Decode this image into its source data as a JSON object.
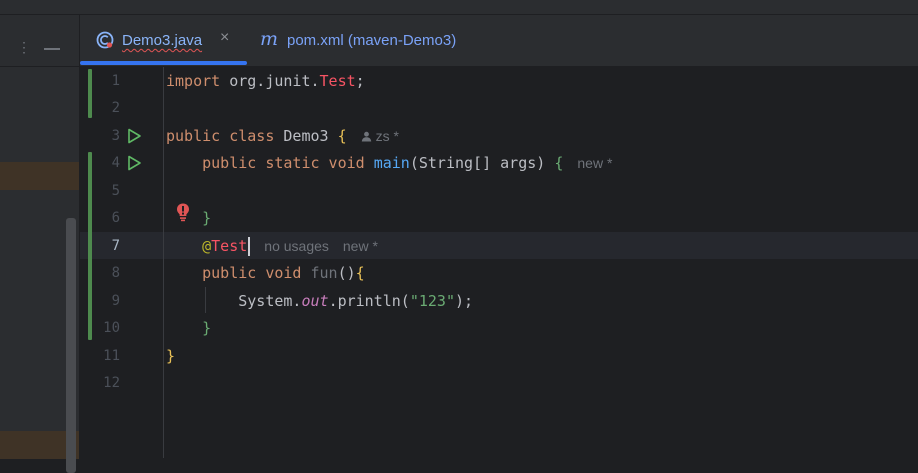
{
  "tabs": [
    {
      "label": "Demo3.java",
      "icon": "java-class-icon",
      "active": true,
      "close": "×"
    },
    {
      "label": "pom.xml (maven-Demo3)",
      "icon": "maven-icon",
      "active": false
    }
  ],
  "left_panel": {
    "menu_glyph": "⋮"
  },
  "editor": {
    "line_numbers": [
      "1",
      "2",
      "3",
      "4",
      "5",
      "6",
      "7",
      "8",
      "9",
      "10",
      "11",
      "12"
    ],
    "current_line": "7",
    "hints": {
      "class_author": "zs *",
      "main_new": "new *",
      "test_usages": "no usages",
      "test_new": "new *"
    },
    "code": {
      "l1_kw": "import",
      "l1_pkg": " org.junit.",
      "l1_cls": "Test",
      "l1_end": ";",
      "l3_kw": "public class",
      "l3_name": " Demo3 ",
      "l3_brace": "{",
      "l4_kw": "public static void",
      "l4_fn": "main",
      "l4_args": "(String[] args) ",
      "l4_brace": "{",
      "l6_brace": "}",
      "l7_at": "@",
      "l7_anno": "Test",
      "l8_kw": "public void",
      "l8_fn": "fun",
      "l8_paren": "()",
      "l8_brace": "{",
      "l9_obj": "System.",
      "l9_field": "out",
      "l9_call": ".println(",
      "l9_str": "\"123\"",
      "l9_end": ");",
      "l10_brace": "}",
      "l11_brace": "}"
    }
  },
  "colors": {
    "keyword": "#cf8e6d",
    "function": "#56a8f5",
    "string": "#6aab73",
    "annotation_name": "#f75464",
    "vcs_added": "#4e8a4e",
    "accent": "#3574f0"
  }
}
